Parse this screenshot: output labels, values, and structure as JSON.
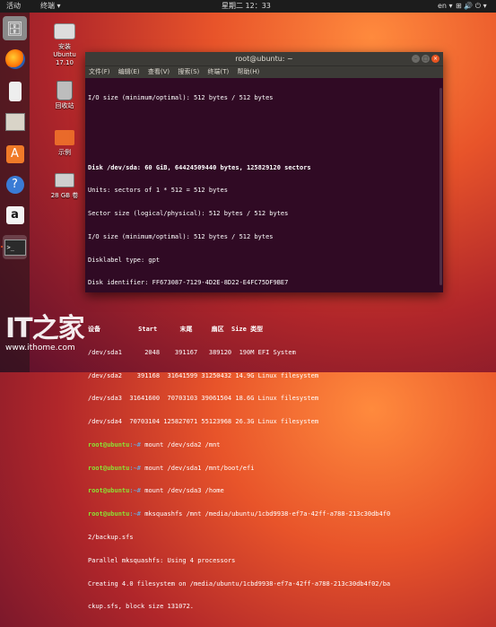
{
  "topbar": {
    "activities": "活动",
    "app_menu": "终端 ▾",
    "clock": "星期二 12：33",
    "lang": "en ▾",
    "system_tray": "⊞ 🔊 ⏻ ▾"
  },
  "dock": {
    "items": [
      "files",
      "firefox",
      "ipod",
      "archive",
      "software",
      "help",
      "amazon",
      "terminal"
    ]
  },
  "desktop": {
    "icons": [
      {
        "name": "install-icon",
        "label_line1": "安装",
        "label_line2": "Ubuntu",
        "label_line3": "17.10"
      },
      {
        "name": "trash-icon",
        "label": "回收站"
      },
      {
        "name": "home-folder-icon",
        "label": "示例"
      },
      {
        "name": "drive-icon",
        "label": "28 GB 卷"
      }
    ]
  },
  "window": {
    "title": "root@ubuntu: ~",
    "menu": [
      "文件(F)",
      "编辑(E)",
      "查看(V)",
      "搜索(S)",
      "终端(T)",
      "帮助(H)"
    ]
  },
  "terminal": {
    "lines": [
      "I/O size (minimum/optimal): 512 bytes / 512 bytes",
      "",
      "",
      "Disk /dev/sda: 60 GiB, 64424509440 bytes, 125829120 sectors",
      "Units: sectors of 1 * 512 = 512 bytes",
      "Sector size (logical/physical): 512 bytes / 512 bytes",
      "I/O size (minimum/optimal): 512 bytes / 512 bytes",
      "Disklabel type: gpt",
      "Disk identifier: FF673087-7129-4D2E-8D22-E4FC75DF9BE7",
      "",
      "设备          Start      末尾     扇区  Size 类型",
      "/dev/sda1      2048    391167   389120  190M EFI System",
      "/dev/sda2    391168  31641599 31250432 14.9G Linux filesystem",
      "/dev/sda3  31641600  70703103 39061504 18.6G Linux filesystem",
      "/dev/sda4  70703104 125827071 55123968 26.3G Linux filesystem"
    ],
    "prompt_user": "root@ubuntu",
    "prompt_path": ":~#",
    "commands": [
      " mount /dev/sda2 /mnt",
      " mount /dev/sda1 /mnt/boot/efi",
      " mount /dev/sda3 /home",
      " mksquashfs /mnt /media/ubuntu/1cbd9938-ef7a-42ff-a788-213c30db4f0"
    ],
    "tail": [
      "2/backup.sfs",
      "Parallel mksquashfs: Using 4 processors",
      "Creating 4.0 filesystem on /media/ubuntu/1cbd9938-ef7a-42ff-a788-213c30db4f02/ba",
      "ckup.sfs, block size 131072."
    ]
  },
  "watermark": {
    "logo": "IT之家",
    "url": "www.ithome.com"
  }
}
